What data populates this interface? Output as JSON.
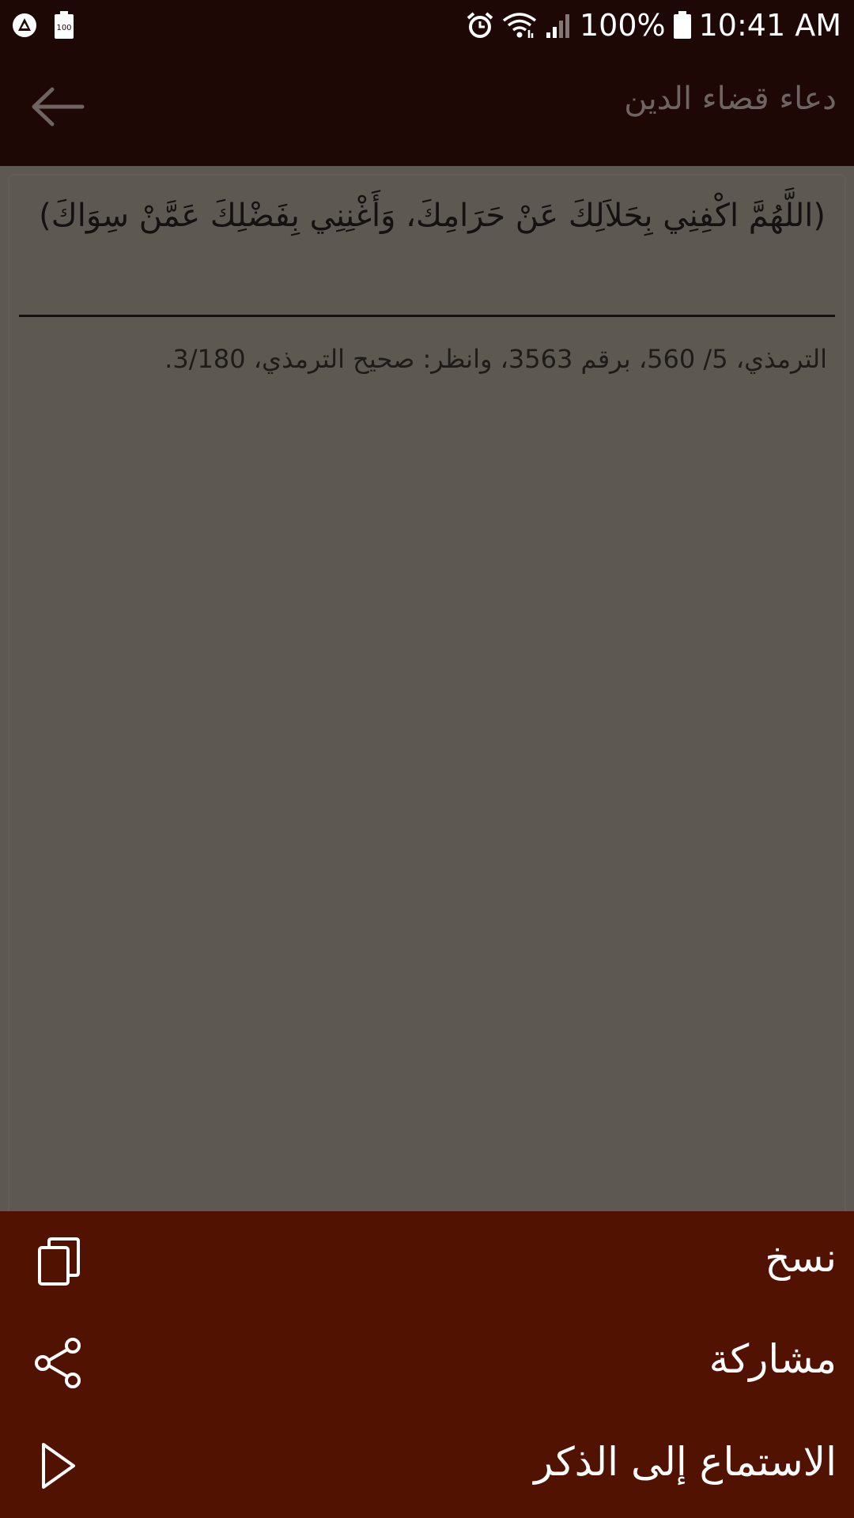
{
  "status_bar": {
    "battery_percent": "100%",
    "time": "10:41 AM",
    "left_icons": [
      "app-notification-icon",
      "battery-saver-icon"
    ],
    "right_icons": [
      "alarm-icon",
      "wifi-icon",
      "signal-icon",
      "battery-icon"
    ]
  },
  "app_bar": {
    "title": "دعاء قضاء الدين",
    "back_icon": "arrow-left-icon"
  },
  "content": {
    "dua": "(اللَّهُمَّ اكْفِنِي بِحَلاَلِكَ عَنْ حَرَامِكَ، وَأَغْنِنِي بِفَضْلِكَ عَمَّنْ سِوَاكَ)",
    "source": "الترمذي، 5/ 560، برقم 3563، وانظر: صحيح الترمذي، 3/180."
  },
  "sheet": {
    "items": [
      {
        "label": "نسخ",
        "icon": "copy-icon"
      },
      {
        "label": "مشاركة",
        "icon": "share-icon"
      },
      {
        "label": "الاستماع إلى الذكر",
        "icon": "play-icon"
      }
    ]
  },
  "colors": {
    "bar": "#1e0805",
    "sheet": "#511202",
    "scrim_content": "#5d5852",
    "title_text": "#6f6461"
  }
}
